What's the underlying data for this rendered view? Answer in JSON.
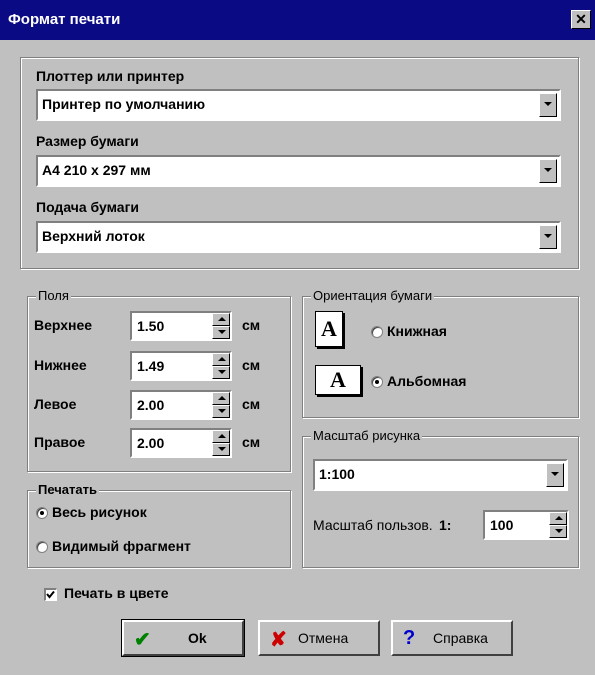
{
  "window": {
    "title": "Формат печати",
    "close_glyph": "✕"
  },
  "printer": {
    "plotter_label": "Плоттер или принтер",
    "plotter_value": "Принтер по умолчанию",
    "paper_size_label": "Размер бумаги",
    "paper_size_value": "A4 210 x 297 мм",
    "paper_feed_label": "Подача бумаги",
    "paper_feed_value": "Верхний лоток"
  },
  "margins": {
    "legend": "Поля",
    "unit": "см",
    "fields": [
      {
        "label": "Верхнее",
        "value": "1.50"
      },
      {
        "label": "Нижнее",
        "value": "1.49"
      },
      {
        "label": "Левое",
        "value": "2.00"
      },
      {
        "label": "Правое",
        "value": "2.00"
      }
    ]
  },
  "orientation": {
    "legend": "Ориентация бумаги",
    "icon_letter": "A",
    "portrait_label": "Книжная",
    "landscape_label": "Альбомная",
    "selected": "landscape"
  },
  "scale": {
    "legend": "Масштаб рисунка",
    "value": "1:100",
    "custom_label": "Масштаб пользов.",
    "custom_prefix": "1:",
    "custom_value": "100"
  },
  "print_area": {
    "legend": "Печатать",
    "whole_label": "Весь рисунок",
    "visible_label": "Видимый фрагмент",
    "selected": "whole"
  },
  "color_print": {
    "label": "Печать в цвете",
    "checked": true
  },
  "buttons": {
    "ok": "Ok",
    "cancel": "Отмена",
    "help": "Справка"
  },
  "colors": {
    "titlebar": "#0a0a84",
    "face": "#c0c0c0",
    "ok_icon": "#008000",
    "cancel_icon": "#cc0000",
    "help_icon": "#0000cc"
  },
  "icons": {
    "ok": "check-icon",
    "cancel": "cross-icon",
    "help": "question-icon"
  }
}
